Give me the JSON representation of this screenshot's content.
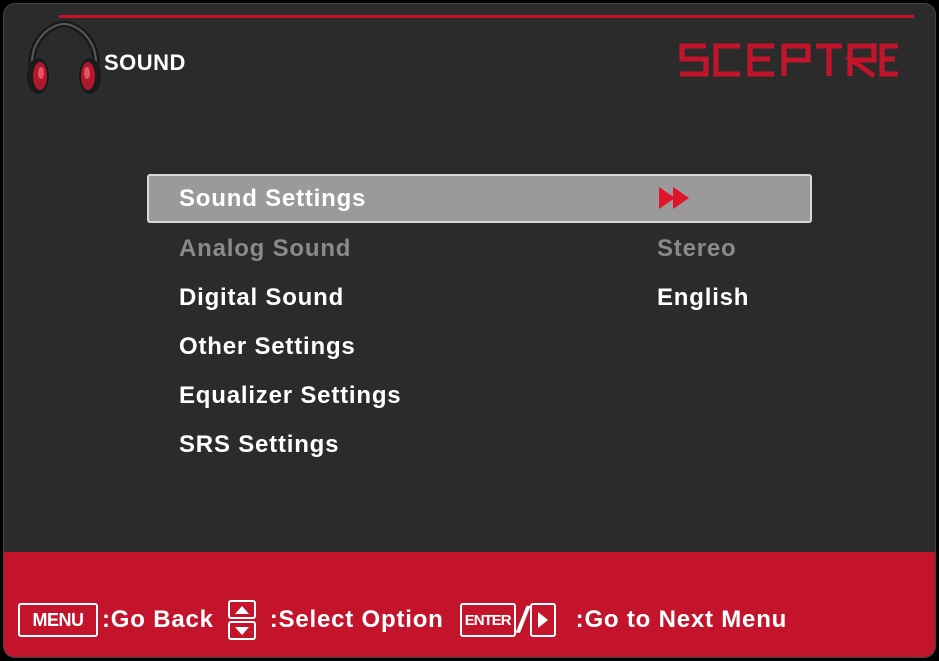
{
  "header": {
    "title": "SOUND",
    "brand": "SCEPTRE",
    "icon": "headphones-icon"
  },
  "menu": {
    "items": [
      {
        "label": "Sound Settings",
        "value": "",
        "state": "selected",
        "icon": "fast-forward-icon"
      },
      {
        "label": "Analog Sound",
        "value": "Stereo",
        "state": "disabled"
      },
      {
        "label": "Digital Sound",
        "value": "English",
        "state": "normal"
      },
      {
        "label": "Other Settings",
        "value": "",
        "state": "normal"
      },
      {
        "label": "Equalizer Settings",
        "value": "",
        "state": "normal"
      },
      {
        "label": "SRS Settings",
        "value": "",
        "state": "normal"
      }
    ]
  },
  "footer": {
    "menu_key": "MENU",
    "back_hint": ":Go Back",
    "select_hint": ":Select Option",
    "enter_key": "ENTER",
    "next_hint": ":Go to Next Menu"
  },
  "colors": {
    "accent": "#c4142c",
    "background": "#2b2b2b",
    "highlight": "#9a9a9a",
    "disabled_text": "#8a8a8a"
  }
}
